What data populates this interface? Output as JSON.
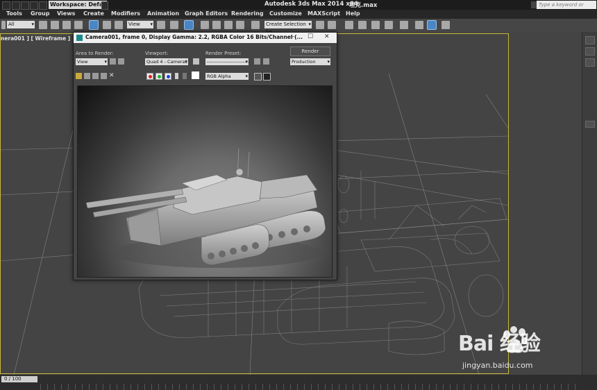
{
  "titlebar": {
    "workspace_label": "Workspace: Defa",
    "app_title": "Autodesk 3ds Max   2014 x64",
    "file_name": "坦克.max",
    "search_placeholder": "Type a keyword or phrase"
  },
  "menubar": {
    "items": [
      "Tools",
      "Group",
      "Views",
      "Create",
      "Modifiers",
      "Animation",
      "Graph Editors",
      "Rendering",
      "Customize",
      "MAXScript",
      "Help"
    ]
  },
  "toolbar": {
    "selection_filter": "All",
    "ref_coord": "View",
    "named_selection": "Create Selection Se"
  },
  "viewport": {
    "label": "nera001 ] [ Wireframe ]"
  },
  "render_window": {
    "title": "Camera001, frame 0, Display Gamma: 2.2, RGBA Color 16 Bits/Channel (...",
    "area_to_render_label": "Area to Render:",
    "area_to_render_value": "View",
    "viewport_label": "Viewport:",
    "viewport_value": "Quad 4 - Camera(",
    "render_preset_label": "Render Preset:",
    "render_preset_value": "----------------------------",
    "render_button": "Render",
    "production_value": "Production",
    "channel_value": "RGB Alpha"
  },
  "timeline": {
    "frame": "0 / 100"
  },
  "watermark": {
    "brand": "Bai  经验",
    "url": "jingyan.baidu.com"
  },
  "colors": {
    "active_viewport_border": "#c9b93a",
    "selection_blue": "#4a86c5"
  }
}
